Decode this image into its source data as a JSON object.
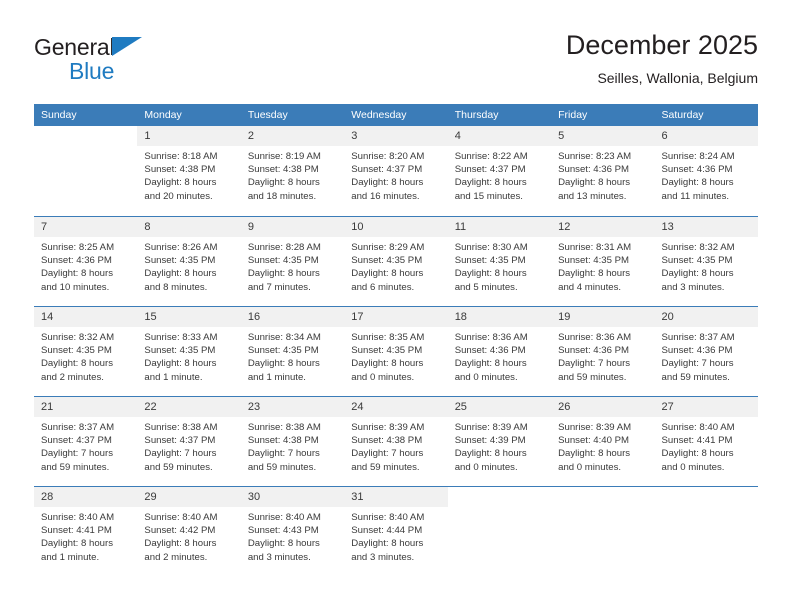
{
  "brand": {
    "name_part1": "General",
    "name_part2": "Blue",
    "triangle_color": "#1f7bc1"
  },
  "header": {
    "title": "December 2025",
    "subtitle": "Seilles, Wallonia, Belgium"
  },
  "theme": {
    "header_bg": "#3b7cb8",
    "daynum_bg": "#f1f1f1",
    "text": "#3a3a3a"
  },
  "weekdays": [
    "Sunday",
    "Monday",
    "Tuesday",
    "Wednesday",
    "Thursday",
    "Friday",
    "Saturday"
  ],
  "weeks": [
    [
      {
        "day": "",
        "lines": []
      },
      {
        "day": "1",
        "lines": [
          "Sunrise: 8:18 AM",
          "Sunset: 4:38 PM",
          "Daylight: 8 hours",
          "and 20 minutes."
        ]
      },
      {
        "day": "2",
        "lines": [
          "Sunrise: 8:19 AM",
          "Sunset: 4:38 PM",
          "Daylight: 8 hours",
          "and 18 minutes."
        ]
      },
      {
        "day": "3",
        "lines": [
          "Sunrise: 8:20 AM",
          "Sunset: 4:37 PM",
          "Daylight: 8 hours",
          "and 16 minutes."
        ]
      },
      {
        "day": "4",
        "lines": [
          "Sunrise: 8:22 AM",
          "Sunset: 4:37 PM",
          "Daylight: 8 hours",
          "and 15 minutes."
        ]
      },
      {
        "day": "5",
        "lines": [
          "Sunrise: 8:23 AM",
          "Sunset: 4:36 PM",
          "Daylight: 8 hours",
          "and 13 minutes."
        ]
      },
      {
        "day": "6",
        "lines": [
          "Sunrise: 8:24 AM",
          "Sunset: 4:36 PM",
          "Daylight: 8 hours",
          "and 11 minutes."
        ]
      }
    ],
    [
      {
        "day": "7",
        "lines": [
          "Sunrise: 8:25 AM",
          "Sunset: 4:36 PM",
          "Daylight: 8 hours",
          "and 10 minutes."
        ]
      },
      {
        "day": "8",
        "lines": [
          "Sunrise: 8:26 AM",
          "Sunset: 4:35 PM",
          "Daylight: 8 hours",
          "and 8 minutes."
        ]
      },
      {
        "day": "9",
        "lines": [
          "Sunrise: 8:28 AM",
          "Sunset: 4:35 PM",
          "Daylight: 8 hours",
          "and 7 minutes."
        ]
      },
      {
        "day": "10",
        "lines": [
          "Sunrise: 8:29 AM",
          "Sunset: 4:35 PM",
          "Daylight: 8 hours",
          "and 6 minutes."
        ]
      },
      {
        "day": "11",
        "lines": [
          "Sunrise: 8:30 AM",
          "Sunset: 4:35 PM",
          "Daylight: 8 hours",
          "and 5 minutes."
        ]
      },
      {
        "day": "12",
        "lines": [
          "Sunrise: 8:31 AM",
          "Sunset: 4:35 PM",
          "Daylight: 8 hours",
          "and 4 minutes."
        ]
      },
      {
        "day": "13",
        "lines": [
          "Sunrise: 8:32 AM",
          "Sunset: 4:35 PM",
          "Daylight: 8 hours",
          "and 3 minutes."
        ]
      }
    ],
    [
      {
        "day": "14",
        "lines": [
          "Sunrise: 8:32 AM",
          "Sunset: 4:35 PM",
          "Daylight: 8 hours",
          "and 2 minutes."
        ]
      },
      {
        "day": "15",
        "lines": [
          "Sunrise: 8:33 AM",
          "Sunset: 4:35 PM",
          "Daylight: 8 hours",
          "and 1 minute."
        ]
      },
      {
        "day": "16",
        "lines": [
          "Sunrise: 8:34 AM",
          "Sunset: 4:35 PM",
          "Daylight: 8 hours",
          "and 1 minute."
        ]
      },
      {
        "day": "17",
        "lines": [
          "Sunrise: 8:35 AM",
          "Sunset: 4:35 PM",
          "Daylight: 8 hours",
          "and 0 minutes."
        ]
      },
      {
        "day": "18",
        "lines": [
          "Sunrise: 8:36 AM",
          "Sunset: 4:36 PM",
          "Daylight: 8 hours",
          "and 0 minutes."
        ]
      },
      {
        "day": "19",
        "lines": [
          "Sunrise: 8:36 AM",
          "Sunset: 4:36 PM",
          "Daylight: 7 hours",
          "and 59 minutes."
        ]
      },
      {
        "day": "20",
        "lines": [
          "Sunrise: 8:37 AM",
          "Sunset: 4:36 PM",
          "Daylight: 7 hours",
          "and 59 minutes."
        ]
      }
    ],
    [
      {
        "day": "21",
        "lines": [
          "Sunrise: 8:37 AM",
          "Sunset: 4:37 PM",
          "Daylight: 7 hours",
          "and 59 minutes."
        ]
      },
      {
        "day": "22",
        "lines": [
          "Sunrise: 8:38 AM",
          "Sunset: 4:37 PM",
          "Daylight: 7 hours",
          "and 59 minutes."
        ]
      },
      {
        "day": "23",
        "lines": [
          "Sunrise: 8:38 AM",
          "Sunset: 4:38 PM",
          "Daylight: 7 hours",
          "and 59 minutes."
        ]
      },
      {
        "day": "24",
        "lines": [
          "Sunrise: 8:39 AM",
          "Sunset: 4:38 PM",
          "Daylight: 7 hours",
          "and 59 minutes."
        ]
      },
      {
        "day": "25",
        "lines": [
          "Sunrise: 8:39 AM",
          "Sunset: 4:39 PM",
          "Daylight: 8 hours",
          "and 0 minutes."
        ]
      },
      {
        "day": "26",
        "lines": [
          "Sunrise: 8:39 AM",
          "Sunset: 4:40 PM",
          "Daylight: 8 hours",
          "and 0 minutes."
        ]
      },
      {
        "day": "27",
        "lines": [
          "Sunrise: 8:40 AM",
          "Sunset: 4:41 PM",
          "Daylight: 8 hours",
          "and 0 minutes."
        ]
      }
    ],
    [
      {
        "day": "28",
        "lines": [
          "Sunrise: 8:40 AM",
          "Sunset: 4:41 PM",
          "Daylight: 8 hours",
          "and 1 minute."
        ]
      },
      {
        "day": "29",
        "lines": [
          "Sunrise: 8:40 AM",
          "Sunset: 4:42 PM",
          "Daylight: 8 hours",
          "and 2 minutes."
        ]
      },
      {
        "day": "30",
        "lines": [
          "Sunrise: 8:40 AM",
          "Sunset: 4:43 PM",
          "Daylight: 8 hours",
          "and 3 minutes."
        ]
      },
      {
        "day": "31",
        "lines": [
          "Sunrise: 8:40 AM",
          "Sunset: 4:44 PM",
          "Daylight: 8 hours",
          "and 3 minutes."
        ]
      },
      {
        "day": "",
        "lines": []
      },
      {
        "day": "",
        "lines": []
      },
      {
        "day": "",
        "lines": []
      }
    ]
  ]
}
